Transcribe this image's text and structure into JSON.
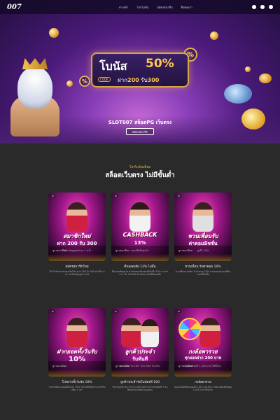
{
  "header": {
    "logo": "007",
    "nav": [
      "ทางเข้า",
      "โปรโมชั่น",
      "สมัครสมาชิก",
      "ติดต่อเรา"
    ],
    "social": [
      "facebook-icon",
      "line-icon",
      "chat-icon"
    ]
  },
  "hero": {
    "bonus_title": "โบนัส",
    "bonus_pct": "50%",
    "bonus_code": "CODE",
    "bonus_sub_pre": "ฝาก",
    "bonus_sub_a": "200",
    "bonus_sub_mid": "รับ",
    "bonus_sub_b": "300",
    "title": "SLOT007 สล็อตPG เว็บตรง",
    "cta": "สมัครสมาชิก"
  },
  "section": {
    "kicker": "โปรโมชั่นสล็อต",
    "title": "สล็อตเว็บตรง ไม่มีขั้นต่ำ"
  },
  "cards": [
    {
      "tag": "Pl",
      "cap1": "สมาชิกใหม่",
      "cap2": "ฝาก 200 รับ 300",
      "cap3": "รับโบนัสสูงสุดวันละ 1 ครั้ง",
      "overlay": "ดูรายละเอียด",
      "label": "สมัครสมาชิกใหม่",
      "desc": "โปรโมชั่นสำหรับสมาชิกใหม่ ฝาก 200 รับ 300 ทำเทิร์น 4 เท่า รับโบนัสสูงสุด 1 ครั้ง"
    },
    {
      "tag": "Pl",
      "cap1": "CASHBACK",
      "cap2": "13%",
      "cap3": "ยอดเสียคืนทุกวัน",
      "overlay": "ดูรายละเอียด",
      "label": "คืนยอดเสีย 13% ไม่อั้น",
      "desc": "คืนยอดเสียทุกวัน สำหรับสมาชิกยอดเสียไม่ถึง 10% และต่ำกว่า 3% รับโบนัส สำหรับสมาชิกที่มียอดเสีย"
    },
    {
      "tag": "Pl",
      "cap1": "ชวนเพื่อนรับ",
      "cap2": "ค่าคอมมิชชั่น",
      "cap3": "สูงถึง 10%",
      "overlay": "ดูรายละเอียด",
      "label": "ชวนเพื่อน รับค่าคอม 10%",
      "desc": "ชวนเพื่อนมาสมัคร รับค่าคอม 10% จากยอดเล่นของเพื่อน ถอนได้ไม่อั้น"
    },
    {
      "tag": "Pl",
      "cap1": "ฝากยอดทั้งวันรับ",
      "cap2": "10%",
      "cap3": "",
      "overlay": "ดูรายละเอียด",
      "label": "โปรฝากทั้งวันรับ 10%",
      "desc": "โปรโมชั่นฝากยอดทั้งวันรับ 10% รับโบนัสได้ทุกวัน ทำเทิร์นเพียง 1 เท่า"
    },
    {
      "tag": "Pl",
      "cap1": "ลูกค้าประจำ",
      "cap2": "รับทันที",
      "cap3": "ฝาก 300 รับ 100 · ฝาก 500 รับ 200",
      "overlay": "ดูรายละเอียด",
      "label": "ลูกค้าประจำรับโบนัสฟรี 200",
      "desc": "สำหรับลูกค้าประจำ ฝาก 300-500 บาท รับโบนัสฟรี 3 วัน ติดต่อรับโบนัสผ่านแอดมิน"
    },
    {
      "tag": "Pl",
      "cap1": "กงล้อพารวย",
      "cap2": "ทุกยอดฝาก 200 บาท",
      "cap3": "ลุ้นเครดิตฟรี 1,000 บาท ได้ทั้งวัน",
      "overlay": "ดูรายละเอียด",
      "label": "กงล้อพารวย",
      "desc": "หมุนกงล้อฟรีทุกยอดฝาก 200 บาท ลุ้นรางวัลเครดิตฟรีสูงสุด 1,000 บาท ได้ทุกวัน"
    }
  ]
}
